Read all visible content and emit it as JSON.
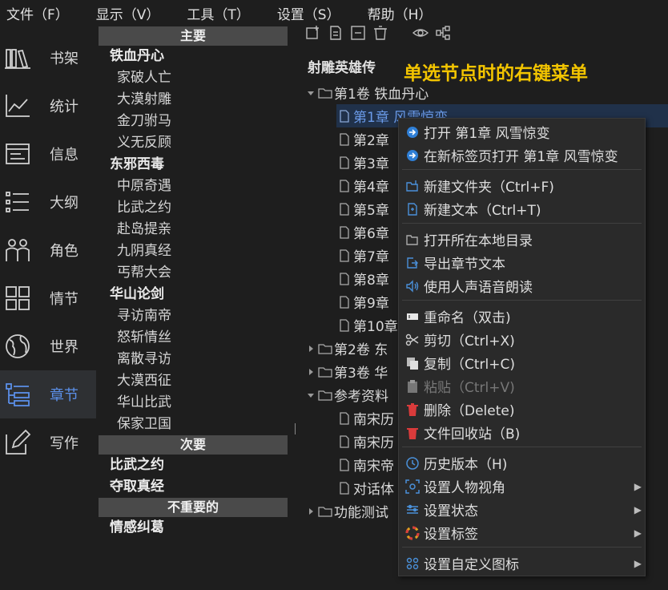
{
  "menubar": [
    "文件（F）",
    "显示（V）",
    "工具（T）",
    "设置（S）",
    "帮助（H）"
  ],
  "nav": [
    {
      "label": "书架",
      "icon": "bookshelf-icon"
    },
    {
      "label": "统计",
      "icon": "chart-icon"
    },
    {
      "label": "信息",
      "icon": "info-card-icon"
    },
    {
      "label": "大纲",
      "icon": "outline-list-icon"
    },
    {
      "label": "角色",
      "icon": "characters-icon"
    },
    {
      "label": "情节",
      "icon": "plot-grid-icon"
    },
    {
      "label": "世界",
      "icon": "globe-icon"
    },
    {
      "label": "章节",
      "icon": "chapter-tree-icon"
    },
    {
      "label": "写作",
      "icon": "pen-icon"
    }
  ],
  "outline": {
    "main_header": "主要",
    "groups": [
      {
        "title": "铁血丹心",
        "items": [
          "家破人亡",
          "大漠射雕",
          "金刀驸马",
          "义无反顾"
        ]
      },
      {
        "title": "东邪西毒",
        "items": [
          "中原奇遇",
          "比武之约",
          "赴岛提亲",
          "九阴真经",
          "丐帮大会"
        ]
      },
      {
        "title": "华山论剑",
        "items": [
          "寻访南帝",
          "怒斩情丝",
          "离散寻访",
          "大漠西征",
          "华山比武",
          "保家卫国"
        ]
      }
    ],
    "secondary_header": "次要",
    "secondary": [
      "比武之约",
      "夺取真经"
    ],
    "minor_header": "不重要的",
    "minor": [
      "情感纠葛"
    ]
  },
  "tree": {
    "title": "射雕英雄传",
    "caption": "单选节点时的右键菜单",
    "vol1": "第1卷 铁血丹心",
    "chapters": [
      "第1章 风雪惊变",
      "第2章",
      "第3章",
      "第4章",
      "第5章",
      "第6章",
      "第7章",
      "第8章",
      "第9章",
      "第10章"
    ],
    "vol2": "第2卷 东",
    "vol3": "第3卷 华",
    "ref": "参考资料",
    "refs": [
      "南宋历",
      "南宋历",
      "南宋帝",
      "对话体"
    ],
    "func": "功能测试"
  },
  "context_menu": [
    {
      "label": "打开 第1章 风雪惊变",
      "icon": "open-arrow-icon"
    },
    {
      "label": "在新标签页打开 第1章 风雪惊变",
      "icon": "open-new-tab-icon"
    },
    {
      "label": "新建文件夹（Ctrl+F)",
      "icon": "new-folder-icon"
    },
    {
      "label": "新建文本（Ctrl+T)",
      "icon": "new-text-icon"
    },
    {
      "label": "打开所在本地目录",
      "icon": "open-folder-icon"
    },
    {
      "label": "导出章节文本",
      "icon": "export-icon"
    },
    {
      "label": "使用人声语音朗读",
      "icon": "speaker-icon"
    },
    {
      "label": "重命名（双击)",
      "icon": "rename-icon"
    },
    {
      "label": "剪切（Ctrl+X)",
      "icon": "scissors-icon"
    },
    {
      "label": "复制（Ctrl+C)",
      "icon": "copy-icon"
    },
    {
      "label": "粘贴（Ctrl+V)",
      "icon": "paste-icon",
      "disabled": true
    },
    {
      "label": "删除（Delete)",
      "icon": "delete-icon"
    },
    {
      "label": "文件回收站（B)",
      "icon": "recycle-bin-icon"
    },
    {
      "label": "历史版本（H)",
      "icon": "history-icon"
    },
    {
      "label": "设置人物视角",
      "icon": "character-view-icon",
      "submenu": true
    },
    {
      "label": "设置状态",
      "icon": "status-icon",
      "submenu": true
    },
    {
      "label": "设置标签",
      "icon": "tag-icon",
      "submenu": true
    },
    {
      "label": "设置自定义图标",
      "icon": "custom-icon",
      "submenu": true
    }
  ],
  "colors": {
    "accent": "#5b8fe8",
    "caption": "#f2c400",
    "delete_red": "#d93b3b",
    "selection": "#20314a"
  }
}
